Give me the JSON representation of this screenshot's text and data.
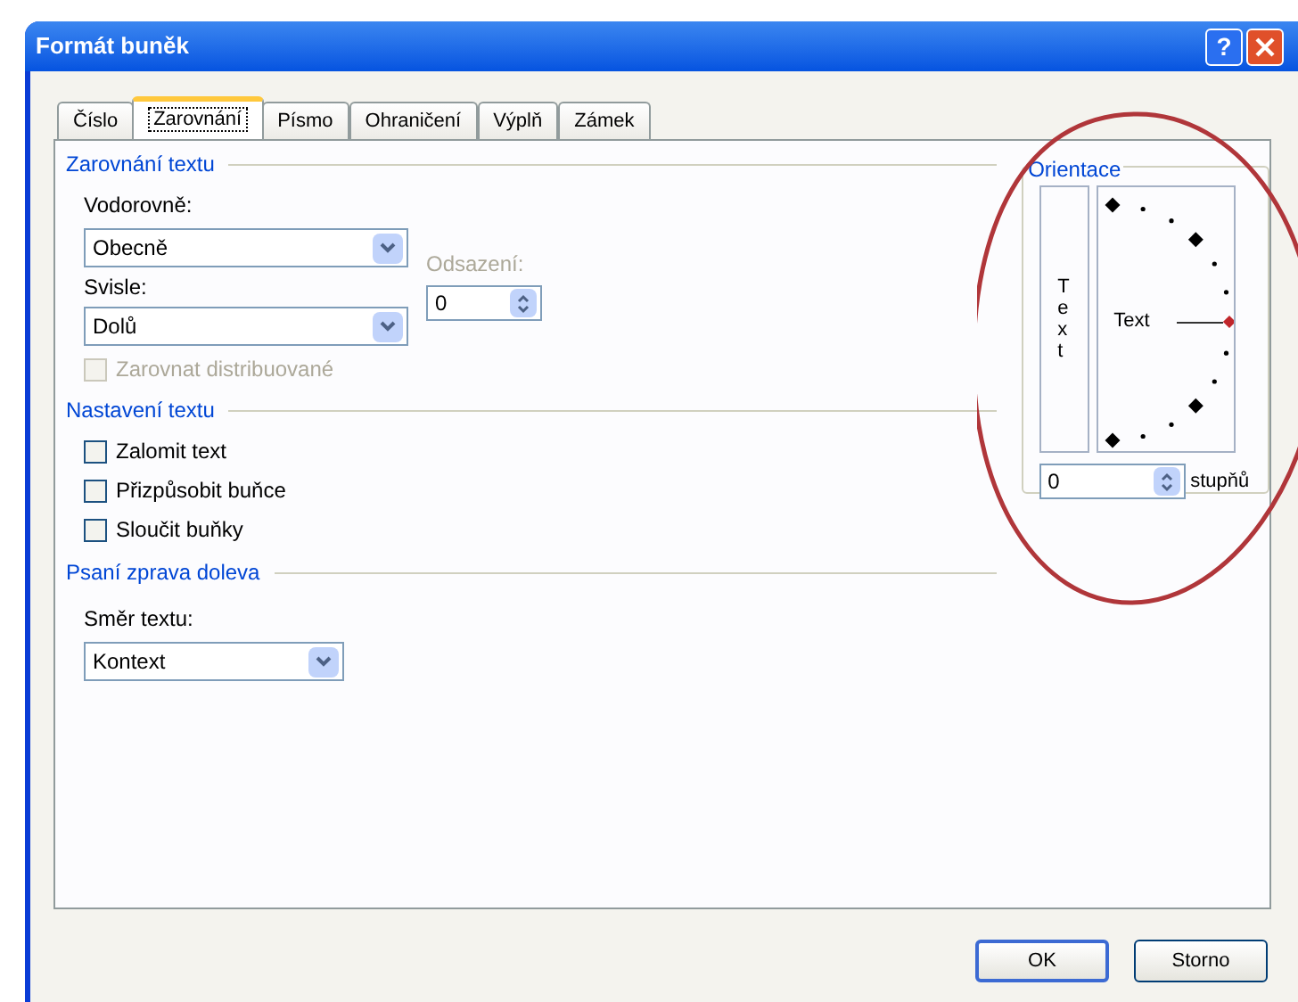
{
  "window": {
    "title": "Formát buněk",
    "help": "?"
  },
  "tabs": [
    {
      "label": "Číslo",
      "selected": false
    },
    {
      "label": "Zarovnání",
      "selected": true
    },
    {
      "label": "Písmo",
      "selected": false
    },
    {
      "label": "Ohraničení",
      "selected": false
    },
    {
      "label": "Výplň",
      "selected": false
    },
    {
      "label": "Zámek",
      "selected": false
    }
  ],
  "text_alignment": {
    "heading": "Zarovnání textu",
    "horizontal": {
      "label": "Vodorovně:",
      "value": "Obecně"
    },
    "vertical": {
      "label": "Svisle:",
      "value": "Dolů"
    },
    "indent": {
      "label": "Odsazení:",
      "value": "0",
      "disabled": true
    },
    "distributed": {
      "label": "Zarovnat distribuované",
      "checked": false,
      "disabled": true
    }
  },
  "text_control": {
    "heading": "Nastavení textu",
    "options": [
      {
        "label": "Zalomit text",
        "checked": false
      },
      {
        "label": "Přizpůsobit buňce",
        "checked": false
      },
      {
        "label": "Sloučit buňky",
        "checked": false
      }
    ]
  },
  "right_to_left": {
    "heading": "Psaní zprava doleva",
    "direction": {
      "label": "Směr textu:",
      "value": "Kontext"
    }
  },
  "orientation": {
    "heading": "Orientace",
    "vertical_text": "Text",
    "dial_text": "Text",
    "degrees": "0",
    "unit": "stupňů"
  },
  "buttons": [
    "OK",
    "Storno"
  ]
}
